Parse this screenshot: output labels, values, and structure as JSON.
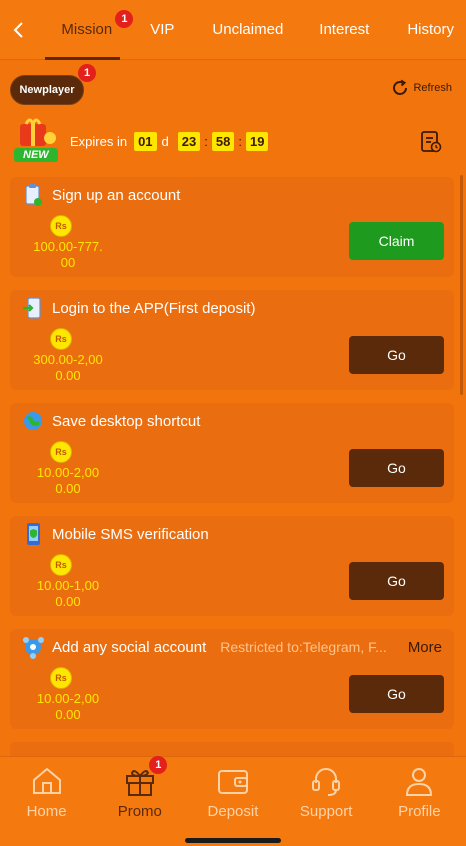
{
  "tabs": [
    {
      "label": "Mission",
      "badge": "1",
      "active": true
    },
    {
      "label": "VIP"
    },
    {
      "label": "Unclaimed"
    },
    {
      "label": "Interest"
    },
    {
      "label": "History"
    }
  ],
  "newplayer": {
    "label": "Newplayer",
    "badge": "1"
  },
  "refresh_label": "Refresh",
  "new_badge": "NEW",
  "expiry": {
    "label": "Expires in",
    "days": "01",
    "day_unit": "d",
    "hours": "23",
    "minutes": "58",
    "seconds": "19"
  },
  "tasks": [
    {
      "title": "Sign up an account",
      "currency": "Rs",
      "amount_line1": "100.00-777.",
      "amount_line2": "00",
      "button": "Claim",
      "button_type": "claim",
      "icon": "clipboard-icon"
    },
    {
      "title": "Login to the APP(First deposit)",
      "currency": "Rs",
      "amount_line1": "300.00-2,00",
      "amount_line2": "0.00",
      "button": "Go",
      "button_type": "go",
      "icon": "app-login-icon"
    },
    {
      "title": "Save desktop shortcut",
      "currency": "Rs",
      "amount_line1": "10.00-2,00",
      "amount_line2": "0.00",
      "button": "Go",
      "button_type": "go",
      "icon": "globe-icon"
    },
    {
      "title": "Mobile SMS verification",
      "currency": "Rs",
      "amount_line1": "10.00-1,00",
      "amount_line2": "0.00",
      "button": "Go",
      "button_type": "go",
      "icon": "phone-shield-icon"
    },
    {
      "title": "Add any social account",
      "restricted": "Restricted to:Telegram, F...",
      "more": "More",
      "currency": "Rs",
      "amount_line1": "10.00-2,00",
      "amount_line2": "0.00",
      "button": "Go",
      "button_type": "go",
      "icon": "social-icon"
    }
  ],
  "bottom_nav": [
    {
      "label": "Home",
      "icon": "home-icon"
    },
    {
      "label": "Promo",
      "icon": "gift-icon",
      "badge": "1",
      "active": true
    },
    {
      "label": "Deposit",
      "icon": "wallet-icon"
    },
    {
      "label": "Support",
      "icon": "headset-icon"
    },
    {
      "label": "Profile",
      "icon": "profile-icon"
    }
  ],
  "colors": {
    "background": "#F2740C",
    "dark_brown": "#5A2A0A",
    "claim_green": "#1E9A1E",
    "timer_yellow": "#FFE600",
    "badge_red": "#E3201B"
  }
}
